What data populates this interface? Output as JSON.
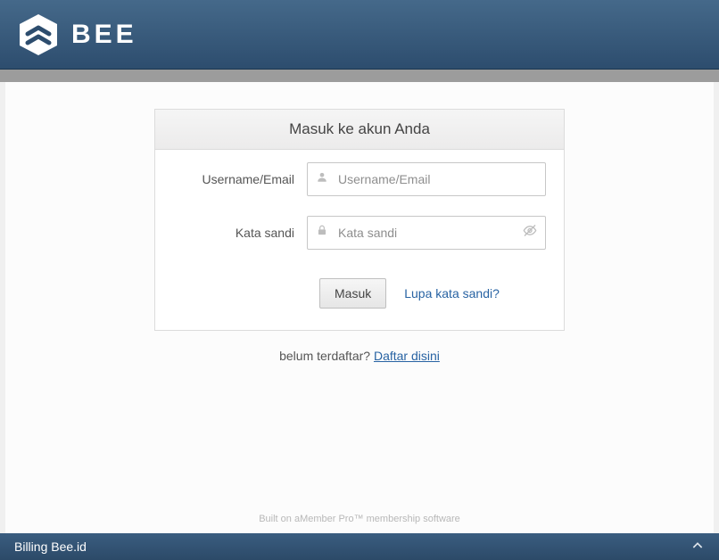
{
  "brand": {
    "name": "BEE"
  },
  "login": {
    "title": "Masuk ke akun Anda",
    "username_label": "Username/Email",
    "username_placeholder": "Username/Email",
    "password_label": "Kata sandi",
    "password_placeholder": "Kata sandi",
    "submit_label": "Masuk",
    "forgot_label": "Lupa kata sandi?"
  },
  "register": {
    "prompt": "belum terdaftar? ",
    "link_label": "Daftar disini"
  },
  "built_on": "Built on aMember Pro™ membership software",
  "footer": {
    "title": "Billing Bee.id"
  }
}
